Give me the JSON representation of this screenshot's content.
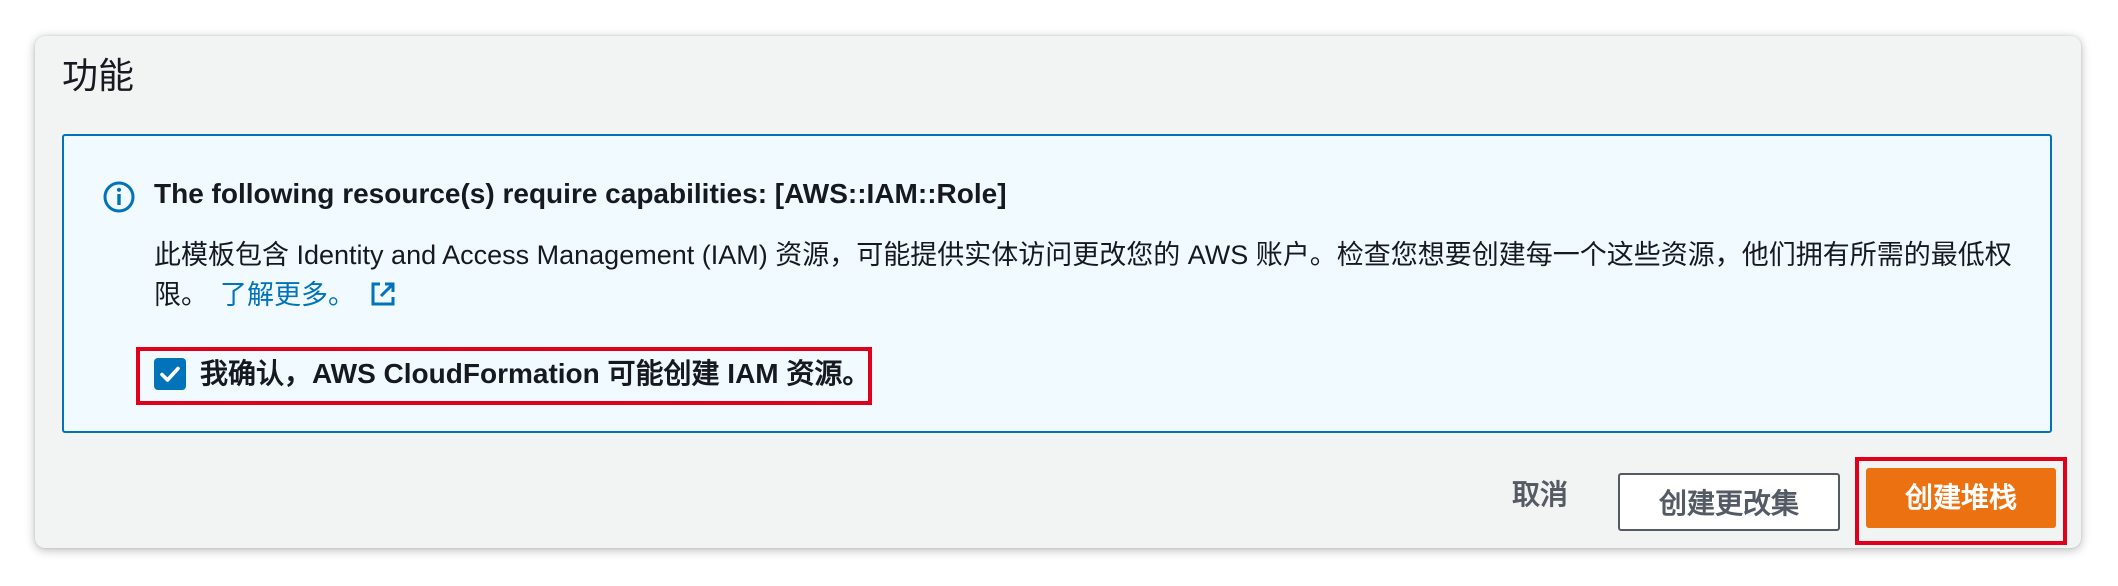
{
  "panel": {
    "title": "功能"
  },
  "info": {
    "icon": "info-icon",
    "heading": "The following resource(s) require capabilities: [AWS::IAM::Role]",
    "body": "此模板包含 Identity and Access Management (IAM) 资源，可能提供实体访问更改您的 AWS 账户。检查您想要创建每一个这些资源，他们拥有所需的最低权限。",
    "learn_more": "了解更多。",
    "external_link_icon": "external-link-icon"
  },
  "acknowledge": {
    "checked": true,
    "label": "我确认，AWS CloudFormation 可能创建 IAM 资源。"
  },
  "actions": {
    "cancel_label": "取消",
    "create_changeset_label": "创建更改集",
    "create_stack_label": "创建堆栈"
  },
  "colors": {
    "info_border": "#0073bb",
    "info_background": "#f1faff",
    "primary_button": "#ec7211",
    "highlight": "#e0001b",
    "link": "#0073bb"
  }
}
